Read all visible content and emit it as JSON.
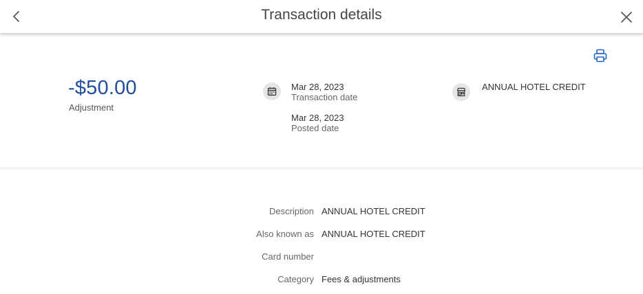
{
  "header": {
    "title": "Transaction details",
    "back_icon": "chevron-left-icon",
    "close_icon": "close-icon"
  },
  "toolbar": {
    "print_icon": "printer-icon"
  },
  "summary": {
    "amount": "-$50.00",
    "amount_type": "Adjustment",
    "date_icon": "calendar-icon",
    "transaction_date_value": "Mar 28, 2023",
    "transaction_date_label": "Transaction date",
    "posted_date_value": "Mar 28, 2023",
    "posted_date_label": "Posted date",
    "merchant_icon": "store-icon",
    "merchant_name": "ANNUAL HOTEL CREDIT"
  },
  "details": [
    {
      "label": "Description",
      "value": "ANNUAL HOTEL CREDIT"
    },
    {
      "label": "Also known as",
      "value": "ANNUAL HOTEL CREDIT"
    },
    {
      "label": "Card number",
      "value": ""
    },
    {
      "label": "Category",
      "value": "Fees & adjustments"
    }
  ],
  "colors": {
    "amount": "#1f4e9c",
    "accent": "#1f63c6",
    "icon_bg": "#e5e5e5"
  }
}
